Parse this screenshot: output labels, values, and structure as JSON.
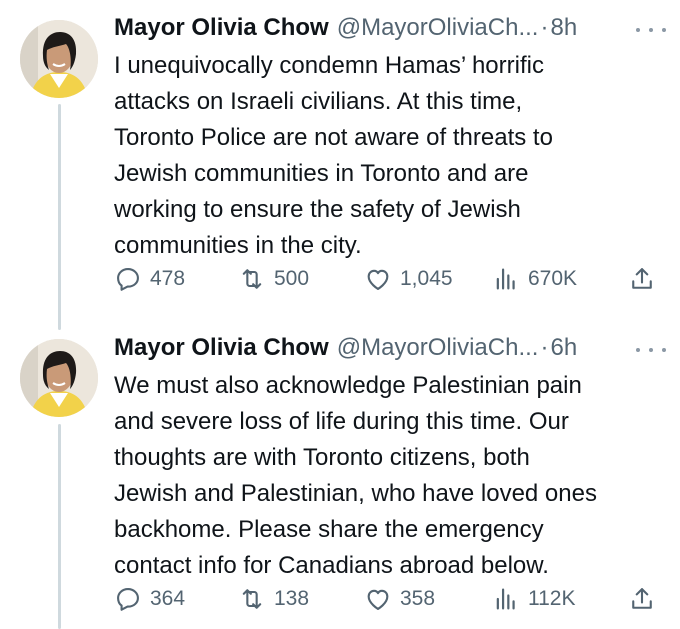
{
  "tweets": [
    {
      "display_name": "Mayor Olivia Chow",
      "handle": "@MayorOliviaCh...",
      "separator": "·",
      "time": "8h",
      "text": "I unequivocally condemn Hamas’ horrific\nattacks on Israeli civilians. At this time,\nToronto Police are not aware of threats to\nJewish communities in Toronto and are\nworking to ensure the safety of Jewish\ncommunities in the city.",
      "replies": "478",
      "reposts": "500",
      "likes": "1,045",
      "views": "670K"
    },
    {
      "display_name": "Mayor Olivia Chow",
      "handle": "@MayorOliviaCh...",
      "separator": "·",
      "time": "6h",
      "text": "We must also acknowledge Palestinian pain\nand severe loss of life during this time. Our\nthoughts are with Toronto citizens, both\nJewish and Palestinian, who have loved ones\nbackhome. Please share the emergency\ncontact info for Canadians abroad below.",
      "replies": "364",
      "reposts": "138",
      "likes": "358",
      "views": "112K"
    }
  ],
  "icons": {
    "reply": "reply-icon",
    "repost": "repost-icon",
    "like": "like-icon",
    "views": "views-icon",
    "share": "share-icon",
    "more": "more-icon"
  },
  "colors": {
    "text": "#0f1419",
    "secondary": "#536471",
    "thread_line": "#cfd9de"
  }
}
